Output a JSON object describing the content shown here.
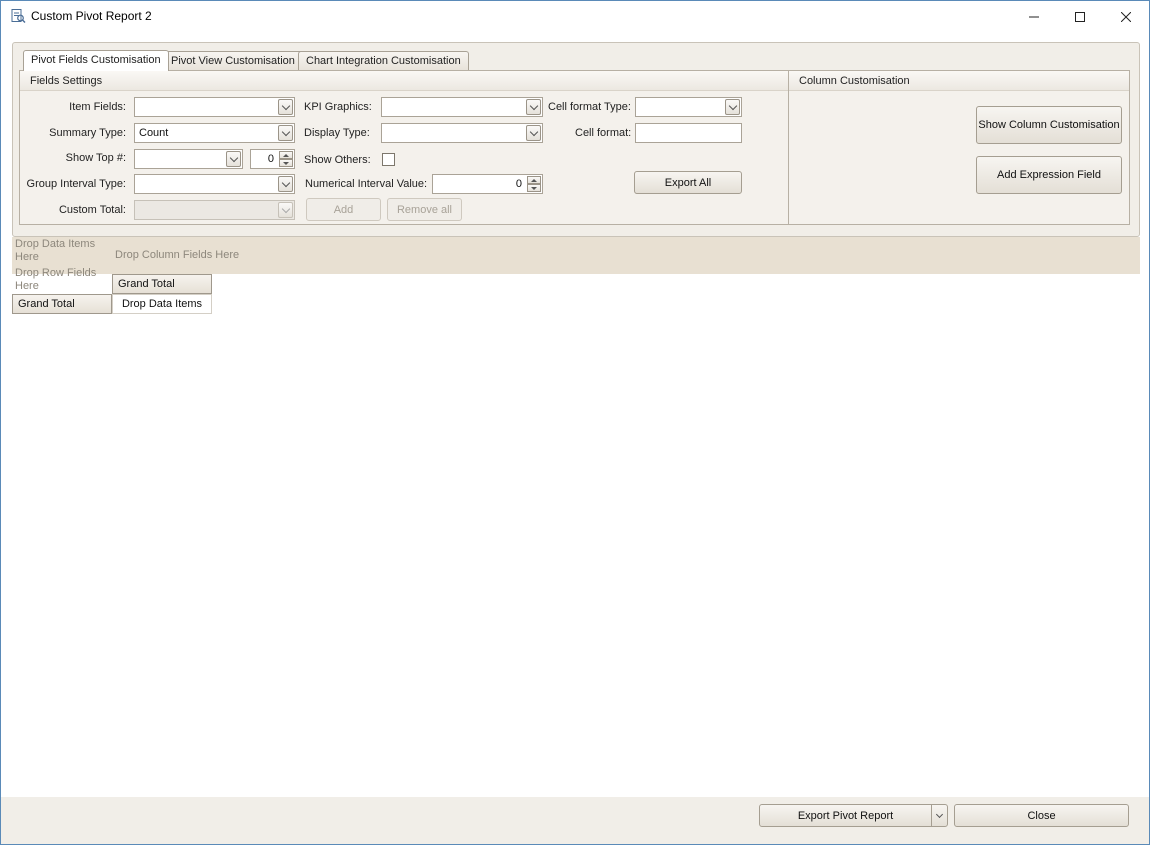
{
  "window": {
    "title": "Custom Pivot Report 2",
    "controls": {
      "minimize": "—",
      "maximize": "☐",
      "close": "✕"
    }
  },
  "tabs": [
    {
      "label": "Pivot Fields Customisation",
      "active": true
    },
    {
      "label": "Pivot View Customisation",
      "active": false
    },
    {
      "label": "Chart Integration Customisation",
      "active": false
    }
  ],
  "fields_settings": {
    "header": "Fields Settings",
    "item_fields": {
      "label": "Item Fields:",
      "value": ""
    },
    "summary_type": {
      "label": "Summary Type:",
      "value": "Count"
    },
    "show_top": {
      "label": "Show Top #:",
      "value": "",
      "count": "0"
    },
    "group_interval_type": {
      "label": "Group Interval Type:",
      "value": ""
    },
    "custom_total": {
      "label": "Custom Total:",
      "value": ""
    },
    "kpi_graphics": {
      "label": "KPI Graphics:",
      "value": ""
    },
    "display_type": {
      "label": "Display Type:",
      "value": ""
    },
    "show_others": {
      "label": "Show Others:",
      "checked": false
    },
    "numerical_interval_value": {
      "label": "Numerical Interval Value:",
      "value": "0"
    },
    "add_button": "Add",
    "remove_all_button": "Remove all",
    "cell_format_type": {
      "label": "Cell format Type:",
      "value": ""
    },
    "cell_format": {
      "label": "Cell format:",
      "value": ""
    },
    "export_all_button": "Export All"
  },
  "column_customisation": {
    "header": "Column Customisation",
    "show_column_button": "Show Column Customisation",
    "add_expression_button": "Add Expression Field"
  },
  "pivot": {
    "drop_data_items_here": "Drop Data Items Here",
    "drop_column_fields_here": "Drop Column Fields Here",
    "drop_row_fields_here": "Drop Row Fields Here",
    "column_grand_total": "Grand Total",
    "row_grand_total": "Grand Total",
    "drop_data_items": "Drop Data Items"
  },
  "footer": {
    "export_pivot_report": "Export Pivot Report",
    "close": "Close"
  }
}
